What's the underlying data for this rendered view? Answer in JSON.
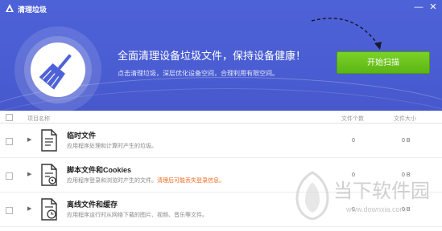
{
  "window": {
    "title": "清理垃圾",
    "minimize_glyph": "—",
    "close_glyph": "✕"
  },
  "hero": {
    "headline": "全面清理设备垃圾文件，保持设备健康！",
    "subline": "点击清理垃圾，深层优化设备空间，合理利用有限空间。",
    "scan_button": "开始扫描",
    "icon": "broom-icon"
  },
  "table": {
    "headers": {
      "name": "项目名称",
      "count": "文件个数",
      "size": "文件大小"
    },
    "rows": [
      {
        "name": "临时文件",
        "desc": "应用程序处理和计算时产生的垃圾。",
        "warn": "",
        "count": "0",
        "size": "0 B",
        "icon": "document-icon"
      },
      {
        "name": "脚本文件和Cookies",
        "desc": "应用程序登录和浏览时产生的文件。",
        "warn": "清理后可能丢失登录信息。",
        "count": "0",
        "size": "0 B",
        "icon": "script-file-icon"
      },
      {
        "name": "离线文件和缓存",
        "desc": "应用程序运行时从网络下载的图片、视频、音乐等文件。",
        "warn": "",
        "count": "0",
        "size": "0 B",
        "icon": "clock-file-icon"
      }
    ]
  },
  "watermark": {
    "brand": "当下软件园",
    "url": "www.downxia.com"
  },
  "colors": {
    "header": "#4e62d8",
    "scan_button": "#6cc31d",
    "warning_text": "#f26a1b"
  }
}
